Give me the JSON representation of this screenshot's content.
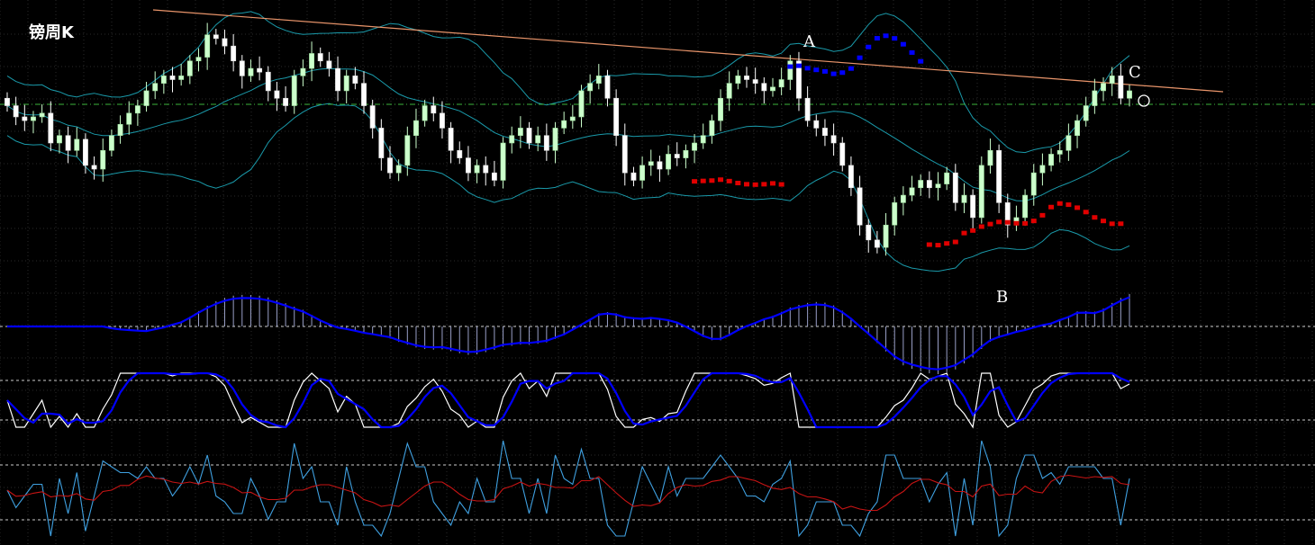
{
  "title": "镑周K",
  "chart_data": {
    "type": "candlestick",
    "colors": {
      "background": "#000000",
      "grid": "#2a2a2a",
      "bull": "#ccffcc",
      "bear": "#ffffff",
      "boll": "#1a9aaa",
      "trend": "#e8946a",
      "dot_up": "#e00000",
      "dot_down": "#0000ff",
      "macd": "#0000ff",
      "kdj_k": "#ffffff",
      "kdj_d": "#0000ff",
      "osc_fast": "#3fa0e0",
      "osc_slow": "#c81414"
    },
    "points": [
      {
        "label": "A",
        "at": 90
      },
      {
        "label": "B",
        "at": 115
      },
      {
        "label": "C",
        "at": 130
      }
    ],
    "close_series": [
      1.56,
      1.545,
      1.54,
      1.545,
      1.55,
      1.51,
      1.52,
      1.5,
      1.515,
      1.48,
      1.475,
      1.5,
      1.52,
      1.535,
      1.55,
      1.56,
      1.58,
      1.59,
      1.6,
      1.595,
      1.6,
      1.62,
      1.625,
      1.655,
      1.65,
      1.64,
      1.62,
      1.6,
      1.61,
      1.605,
      1.58,
      1.57,
      1.56,
      1.6,
      1.61,
      1.63,
      1.62,
      1.61,
      1.58,
      1.6,
      1.59,
      1.56,
      1.53,
      1.49,
      1.47,
      1.48,
      1.52,
      1.54,
      1.56,
      1.55,
      1.53,
      1.5,
      1.49,
      1.47,
      1.48,
      1.47,
      1.46,
      1.51,
      1.52,
      1.53,
      1.51,
      1.52,
      1.5,
      1.53,
      1.54,
      1.545,
      1.58,
      1.59,
      1.6,
      1.57,
      1.52,
      1.47,
      1.46,
      1.48,
      1.485,
      1.475,
      1.495,
      1.49,
      1.5,
      1.51,
      1.52,
      1.54,
      1.57,
      1.59,
      1.6,
      1.595,
      1.59,
      1.58,
      1.585,
      1.595,
      1.62,
      1.57,
      1.54,
      1.53,
      1.52,
      1.51,
      1.48,
      1.45,
      1.4,
      1.38,
      1.37,
      1.4,
      1.43,
      1.44,
      1.45,
      1.46,
      1.45,
      1.455,
      1.47,
      1.43,
      1.44,
      1.41,
      1.48,
      1.5,
      1.43,
      1.4,
      1.41,
      1.44,
      1.47,
      1.48,
      1.495,
      1.5,
      1.52,
      1.54,
      1.56,
      1.58,
      1.59,
      1.6,
      1.57,
      1.58
    ]
  }
}
